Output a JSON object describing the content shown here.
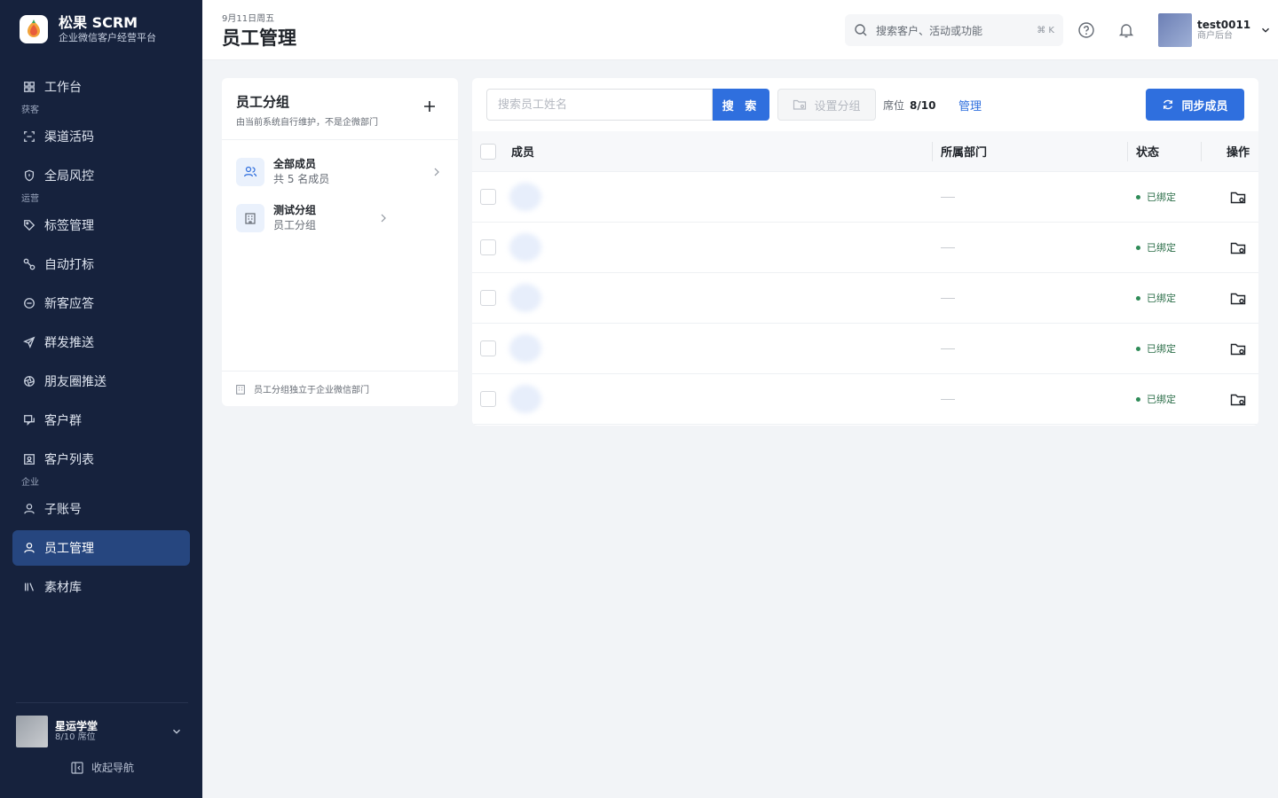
{
  "brand": {
    "name": "松果 SCRM",
    "subtitle": "企业微信客户经营平台"
  },
  "nav": {
    "workbench": "工作台",
    "section_acquire": "获客",
    "channel_code": "渠道活码",
    "risk_control": "全局风控",
    "section_operate": "运营",
    "tag_manage": "标签管理",
    "auto_tag": "自动打标",
    "new_reply": "新客应答",
    "mass_push": "群发推送",
    "moments_push": "朋友圈推送",
    "customer_group": "客户群",
    "customer_list": "客户列表",
    "section_enterprise": "企业",
    "sub_account": "子账号",
    "staff_manage": "员工管理",
    "material": "素材库"
  },
  "org": {
    "name": "星运学堂",
    "seats": "8/10 席位"
  },
  "sidebar_collapse": "收起导航",
  "header": {
    "date": "9月11日周五",
    "title": "员工管理",
    "search_placeholder": "搜索客户、活动或功能",
    "shortcut": "⌘ K",
    "user_name": "test0011",
    "user_role": "商户后台"
  },
  "group_panel": {
    "title": "员工分组",
    "subtitle": "由当前系统自行维护，不是企微部门",
    "groups": [
      {
        "name": "全部成员",
        "sub": "共 5 名成员"
      },
      {
        "name": "测试分组",
        "sub": "员工分组"
      }
    ],
    "footer": "员工分组独立于企业微信部门"
  },
  "member_panel": {
    "search_placeholder": "搜索员工姓名",
    "search_button": "搜 索",
    "set_group": "设置分组",
    "seats_label": "席位",
    "seats_value": "8/10",
    "manage": "管理",
    "sync": "同步成员",
    "columns": {
      "member": "成员",
      "dept": "所属部门",
      "status": "状态",
      "op": "操作"
    },
    "rows": [
      {
        "status": "已绑定"
      },
      {
        "status": "已绑定"
      },
      {
        "status": "已绑定"
      },
      {
        "status": "已绑定"
      },
      {
        "status": "已绑定"
      }
    ]
  },
  "colors": {
    "sidebar": "#16223d",
    "active_nav": "#26467f",
    "primary": "#2f6fde",
    "status_green": "#2e8b57"
  }
}
